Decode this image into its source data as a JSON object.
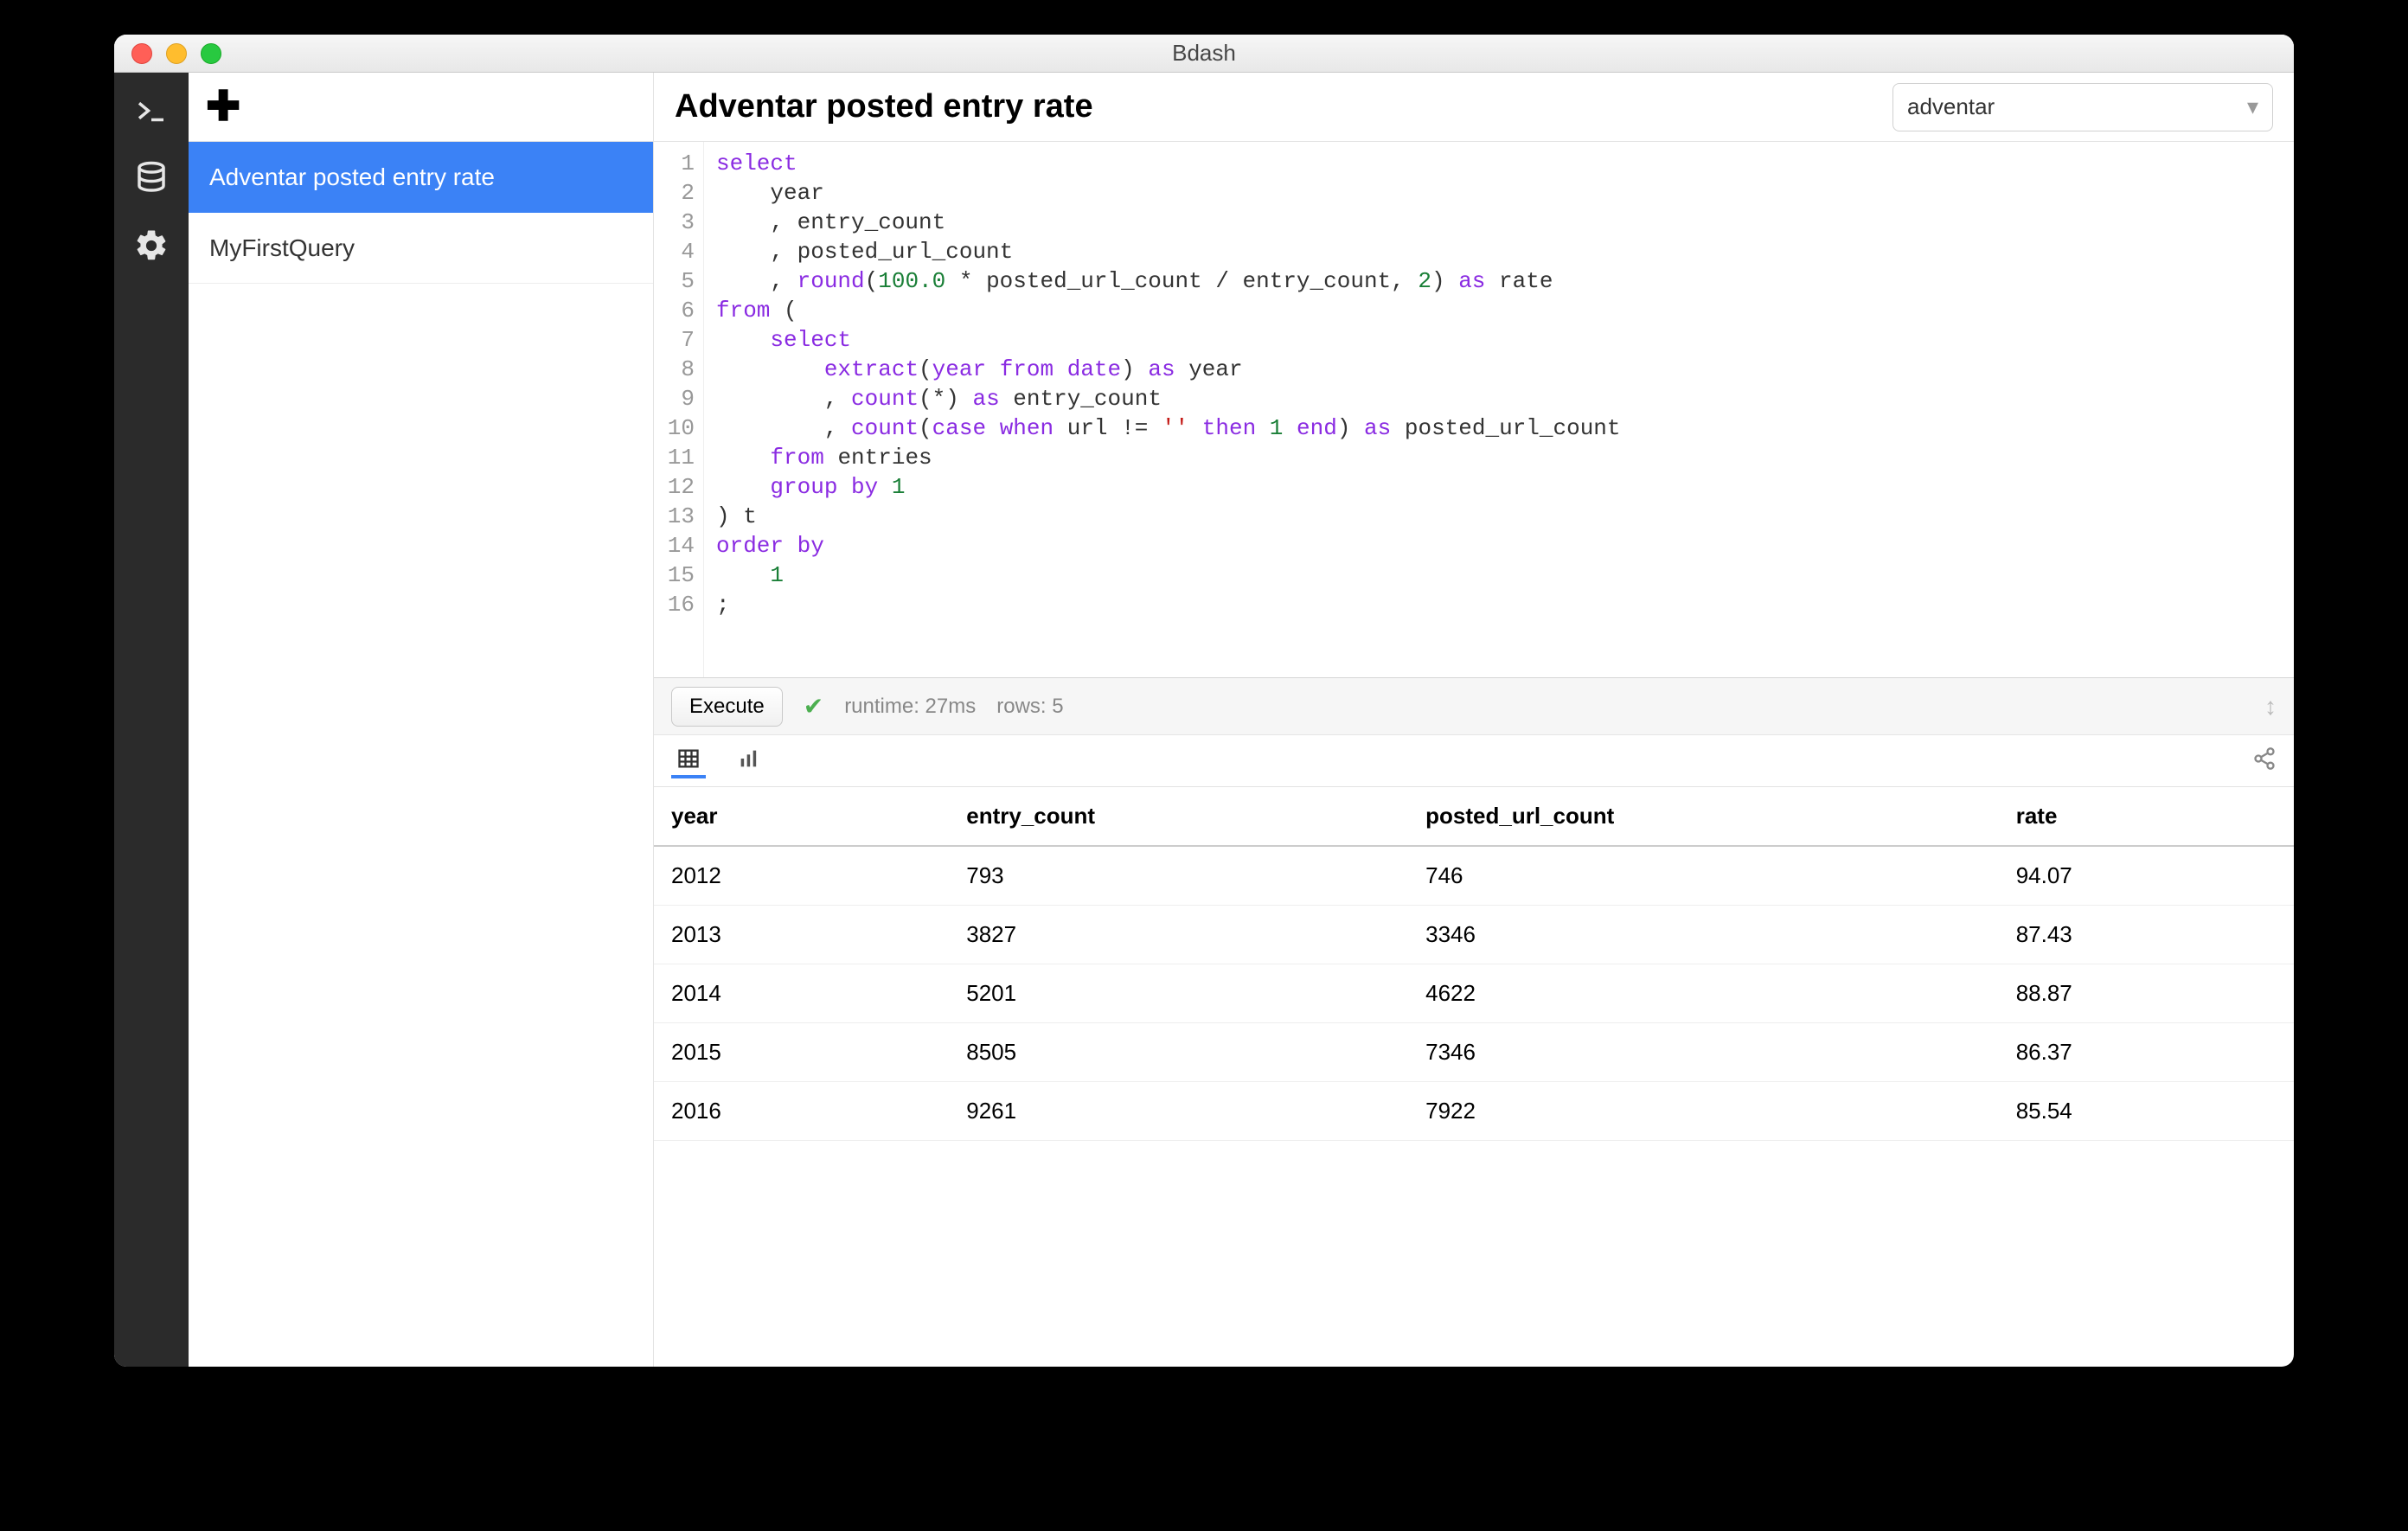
{
  "window": {
    "title": "Bdash"
  },
  "navrail": {
    "items": [
      {
        "name": "terminal-icon"
      },
      {
        "name": "database-icon"
      },
      {
        "name": "gear-icon"
      }
    ]
  },
  "sidebar": {
    "items": [
      {
        "label": "Adventar posted entry rate",
        "selected": true
      },
      {
        "label": "MyFirstQuery",
        "selected": false
      }
    ]
  },
  "header": {
    "title": "Adventar posted entry rate",
    "db_selected": "adventar"
  },
  "editor": {
    "line_count": 16,
    "tokens": [
      [
        [
          "select",
          "kw"
        ]
      ],
      [
        [
          "    ",
          ""
        ],
        [
          "year",
          "id"
        ]
      ],
      [
        [
          "    , entry_count",
          ""
        ]
      ],
      [
        [
          "    , posted_url_count",
          ""
        ]
      ],
      [
        [
          "    , ",
          ""
        ],
        [
          "round",
          "fn"
        ],
        [
          "(",
          ""
        ],
        [
          "100.0",
          "num"
        ],
        [
          " * posted_url_count / entry_count, ",
          ""
        ],
        [
          "2",
          "num"
        ],
        [
          ") ",
          ""
        ],
        [
          "as",
          "kw"
        ],
        [
          " rate",
          ""
        ]
      ],
      [
        [
          "from",
          "kw"
        ],
        [
          " (",
          ""
        ]
      ],
      [
        [
          "    ",
          ""
        ],
        [
          "select",
          "kw"
        ]
      ],
      [
        [
          "        ",
          ""
        ],
        [
          "extract",
          "fn"
        ],
        [
          "(",
          ""
        ],
        [
          "year",
          "kw"
        ],
        [
          " ",
          ""
        ],
        [
          "from",
          "kw"
        ],
        [
          " ",
          ""
        ],
        [
          "date",
          "kw"
        ],
        [
          ") ",
          ""
        ],
        [
          "as",
          "kw"
        ],
        [
          " ",
          ""
        ],
        [
          "year",
          "id"
        ]
      ],
      [
        [
          "        , ",
          ""
        ],
        [
          "count",
          "fn"
        ],
        [
          "(*) ",
          ""
        ],
        [
          "as",
          "kw"
        ],
        [
          " entry_count",
          ""
        ]
      ],
      [
        [
          "        , ",
          ""
        ],
        [
          "count",
          "fn"
        ],
        [
          "(",
          ""
        ],
        [
          "case",
          "kw"
        ],
        [
          " ",
          ""
        ],
        [
          "when",
          "kw"
        ],
        [
          " url != ",
          ""
        ],
        [
          "''",
          "str"
        ],
        [
          " ",
          ""
        ],
        [
          "then",
          "kw"
        ],
        [
          " ",
          ""
        ],
        [
          "1",
          "num"
        ],
        [
          " ",
          ""
        ],
        [
          "end",
          "kw"
        ],
        [
          ") ",
          ""
        ],
        [
          "as",
          "kw"
        ],
        [
          " posted_url_count",
          ""
        ]
      ],
      [
        [
          "    ",
          ""
        ],
        [
          "from",
          "kw"
        ],
        [
          " entries",
          ""
        ]
      ],
      [
        [
          "    ",
          ""
        ],
        [
          "group by",
          "kw"
        ],
        [
          " ",
          ""
        ],
        [
          "1",
          "num"
        ]
      ],
      [
        [
          ") t",
          ""
        ]
      ],
      [
        [
          "order by",
          "kw"
        ]
      ],
      [
        [
          "    ",
          ""
        ],
        [
          "1",
          "num"
        ]
      ],
      [
        [
          ";",
          ""
        ]
      ]
    ]
  },
  "runbar": {
    "execute_label": "Execute",
    "runtime_label": "runtime: 27ms",
    "rows_label": "rows: 5"
  },
  "results": {
    "columns": [
      "year",
      "entry_count",
      "posted_url_count",
      "rate"
    ],
    "rows": [
      [
        "2012",
        "793",
        "746",
        "94.07"
      ],
      [
        "2013",
        "3827",
        "3346",
        "87.43"
      ],
      [
        "2014",
        "5201",
        "4622",
        "88.87"
      ],
      [
        "2015",
        "8505",
        "7346",
        "86.37"
      ],
      [
        "2016",
        "9261",
        "7922",
        "85.54"
      ]
    ]
  },
  "chart_data": {
    "type": "table",
    "title": "Adventar posted entry rate",
    "columns": [
      "year",
      "entry_count",
      "posted_url_count",
      "rate"
    ],
    "rows": [
      {
        "year": 2012,
        "entry_count": 793,
        "posted_url_count": 746,
        "rate": 94.07
      },
      {
        "year": 2013,
        "entry_count": 3827,
        "posted_url_count": 3346,
        "rate": 87.43
      },
      {
        "year": 2014,
        "entry_count": 5201,
        "posted_url_count": 4622,
        "rate": 88.87
      },
      {
        "year": 2015,
        "entry_count": 8505,
        "posted_url_count": 7346,
        "rate": 86.37
      },
      {
        "year": 2016,
        "entry_count": 9261,
        "posted_url_count": 7922,
        "rate": 85.54
      }
    ]
  }
}
